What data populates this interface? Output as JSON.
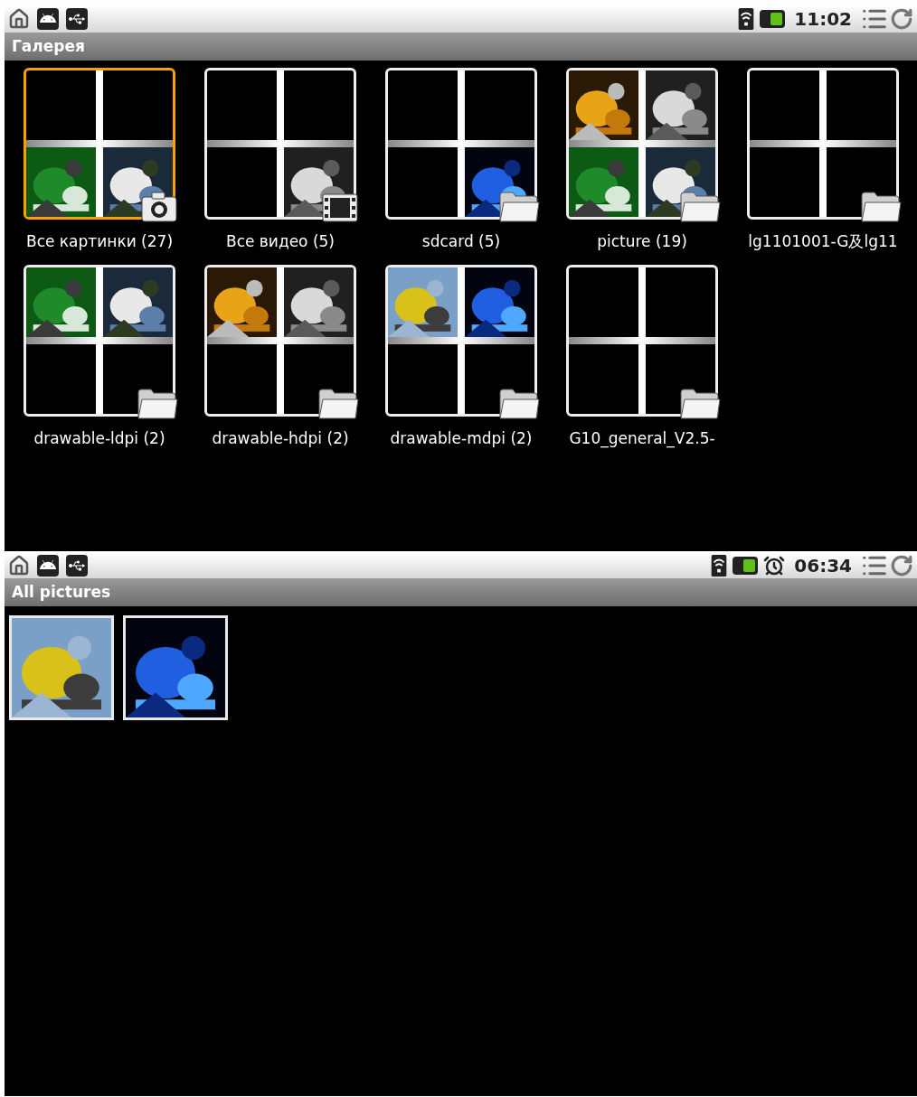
{
  "screens": [
    {
      "status_bar": {
        "time": "11:02",
        "alarm": false
      },
      "title": "Галерея",
      "kind": "albums",
      "albums": [
        {
          "name": "Все картинки (27)",
          "selected": true,
          "kind": "camera",
          "thumbs": [
            {
              "kind": "empty"
            },
            {
              "kind": "empty"
            },
            {
              "kind": "picture"
            },
            {
              "kind": "picture"
            }
          ]
        },
        {
          "name": "Все видео (5)",
          "selected": false,
          "kind": "film",
          "thumbs": [
            {
              "kind": "empty"
            },
            {
              "kind": "empty"
            },
            {
              "kind": "empty"
            },
            {
              "kind": "picture"
            }
          ]
        },
        {
          "name": "sdcard (5)",
          "selected": false,
          "kind": "folder",
          "thumbs": [
            {
              "kind": "empty"
            },
            {
              "kind": "empty"
            },
            {
              "kind": "empty"
            },
            {
              "kind": "picture"
            }
          ]
        },
        {
          "name": "picture (19)",
          "selected": false,
          "kind": "folder",
          "thumbs": [
            {
              "kind": "picture"
            },
            {
              "kind": "picture"
            },
            {
              "kind": "picture"
            },
            {
              "kind": "picture"
            }
          ]
        },
        {
          "name": "lg1101001-G及lg11",
          "selected": false,
          "kind": "folder",
          "thumbs": [
            {
              "kind": "empty"
            },
            {
              "kind": "empty"
            },
            {
              "kind": "empty"
            },
            {
              "kind": "empty"
            }
          ]
        },
        {
          "name": "drawable-ldpi (2)",
          "selected": false,
          "kind": "folder",
          "thumbs": [
            {
              "kind": "picture"
            },
            {
              "kind": "picture"
            },
            {
              "kind": "empty"
            },
            {
              "kind": "empty"
            }
          ]
        },
        {
          "name": "drawable-hdpi (2)",
          "selected": false,
          "kind": "folder",
          "thumbs": [
            {
              "kind": "picture"
            },
            {
              "kind": "picture"
            },
            {
              "kind": "empty"
            },
            {
              "kind": "empty"
            }
          ]
        },
        {
          "name": "drawable-mdpi (2)",
          "selected": false,
          "kind": "folder",
          "thumbs": [
            {
              "kind": "picture"
            },
            {
              "kind": "picture"
            },
            {
              "kind": "empty"
            },
            {
              "kind": "empty"
            }
          ]
        },
        {
          "name": "G10_general_V2.5-",
          "selected": false,
          "kind": "folder",
          "thumbs": [
            {
              "kind": "empty"
            },
            {
              "kind": "empty"
            },
            {
              "kind": "empty"
            },
            {
              "kind": "empty"
            }
          ]
        }
      ]
    },
    {
      "status_bar": {
        "time": "06:34",
        "alarm": true
      },
      "title": "All pictures",
      "kind": "pictures",
      "pictures": [
        {
          "kind": "picture"
        },
        {
          "kind": "picture"
        }
      ]
    }
  ]
}
